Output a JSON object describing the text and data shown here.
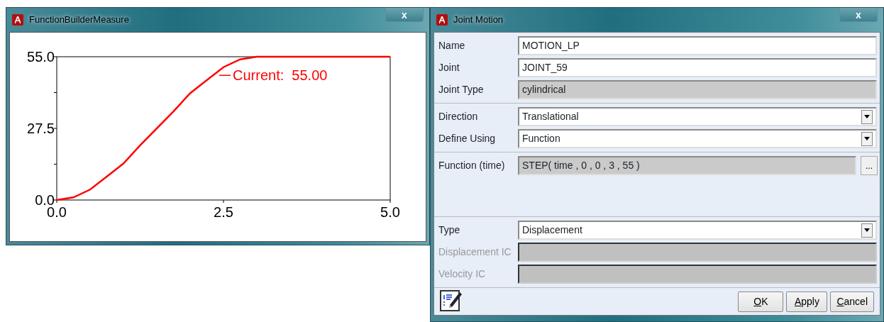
{
  "plot_window": {
    "title": "FunctionBuilderMeasure",
    "close": "x",
    "chart": {
      "chart_data": {
        "type": "line",
        "x": [
          0,
          0.25,
          0.5,
          0.75,
          1,
          1.25,
          1.5,
          1.75,
          2,
          2.25,
          2.5,
          2.75,
          3,
          3.25,
          3.5,
          3.75,
          4,
          4.25,
          4.5,
          4.75,
          5
        ],
        "series": [
          {
            "color": "#ff0000",
            "values": [
              0,
              1,
              4,
              9,
              14,
              21,
              27.5,
              34,
              41,
              46,
              51,
              54,
              55,
              55,
              55,
              55,
              55,
              55,
              55,
              55,
              55
            ]
          }
        ],
        "xlim": [
          0,
          5
        ],
        "ylim": [
          0,
          55
        ],
        "xticks": [
          {
            "value": 0,
            "label": "0.0"
          },
          {
            "value": 2.5,
            "label": "2.5"
          },
          {
            "value": 5,
            "label": "5.0"
          }
        ],
        "yticks": [
          {
            "value": 0,
            "label": "0.0"
          },
          {
            "value": 27.5,
            "label": "27.5"
          },
          {
            "value": 55,
            "label": "55.0"
          }
        ],
        "annotations": [
          "Current:  55.00"
        ]
      }
    }
  },
  "dialog": {
    "title": "Joint Motion",
    "close": "x",
    "sections": [
      [
        {
          "label": "Name",
          "kind": "text",
          "value": "MOTION_LP",
          "disabled": false
        },
        {
          "label": "Joint",
          "kind": "text",
          "value": "JOINT_59",
          "disabled": false
        },
        {
          "label": "Joint Type",
          "kind": "readonly",
          "value": "cylindrical",
          "disabled": false
        }
      ],
      [
        {
          "label": "Direction",
          "kind": "select",
          "value": "Translational",
          "disabled": false
        },
        {
          "label": "Define Using",
          "kind": "select",
          "value": "Function",
          "disabled": false
        }
      ],
      [
        {
          "label": "Function (time)",
          "kind": "function",
          "value": "STEP( time , 0 , 0 , 3 , 55 )",
          "button": "...",
          "disabled": false
        }
      ],
      [
        {
          "label": "Type",
          "kind": "select",
          "value": "Displacement",
          "disabled": false
        },
        {
          "label": "Displacement IC",
          "kind": "text",
          "disabled": true
        },
        {
          "label": "Velocity IC",
          "kind": "text",
          "disabled": true
        }
      ]
    ],
    "buttons": [
      "OK",
      "Apply",
      "Cancel"
    ]
  }
}
